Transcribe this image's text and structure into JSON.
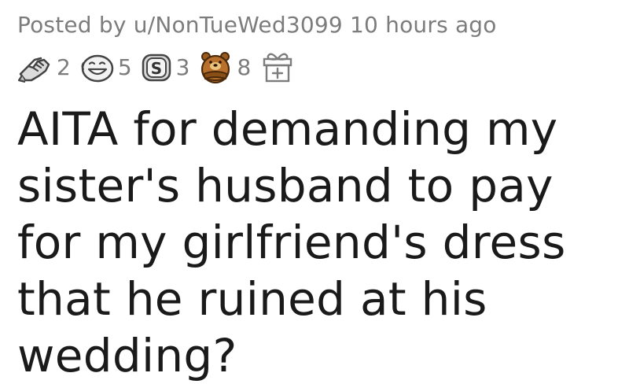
{
  "post": {
    "posted_by_prefix": "Posted by",
    "username": "u/NonTueWed3099",
    "time_ago": "10 hours ago",
    "awards": [
      {
        "icon": "wholesome-hands-icon",
        "count": "2"
      },
      {
        "icon": "laughing-face-icon",
        "count": "5"
      },
      {
        "icon": "silver-s-coin-icon",
        "count": "3"
      },
      {
        "icon": "bear-arms-crossed-icon",
        "count": "8"
      }
    ],
    "give_award_icon": "gift-box-icon",
    "title": "AITA for demanding my sister's husband to pay for my girlfriend's dress that he ruined at his wedding?"
  }
}
